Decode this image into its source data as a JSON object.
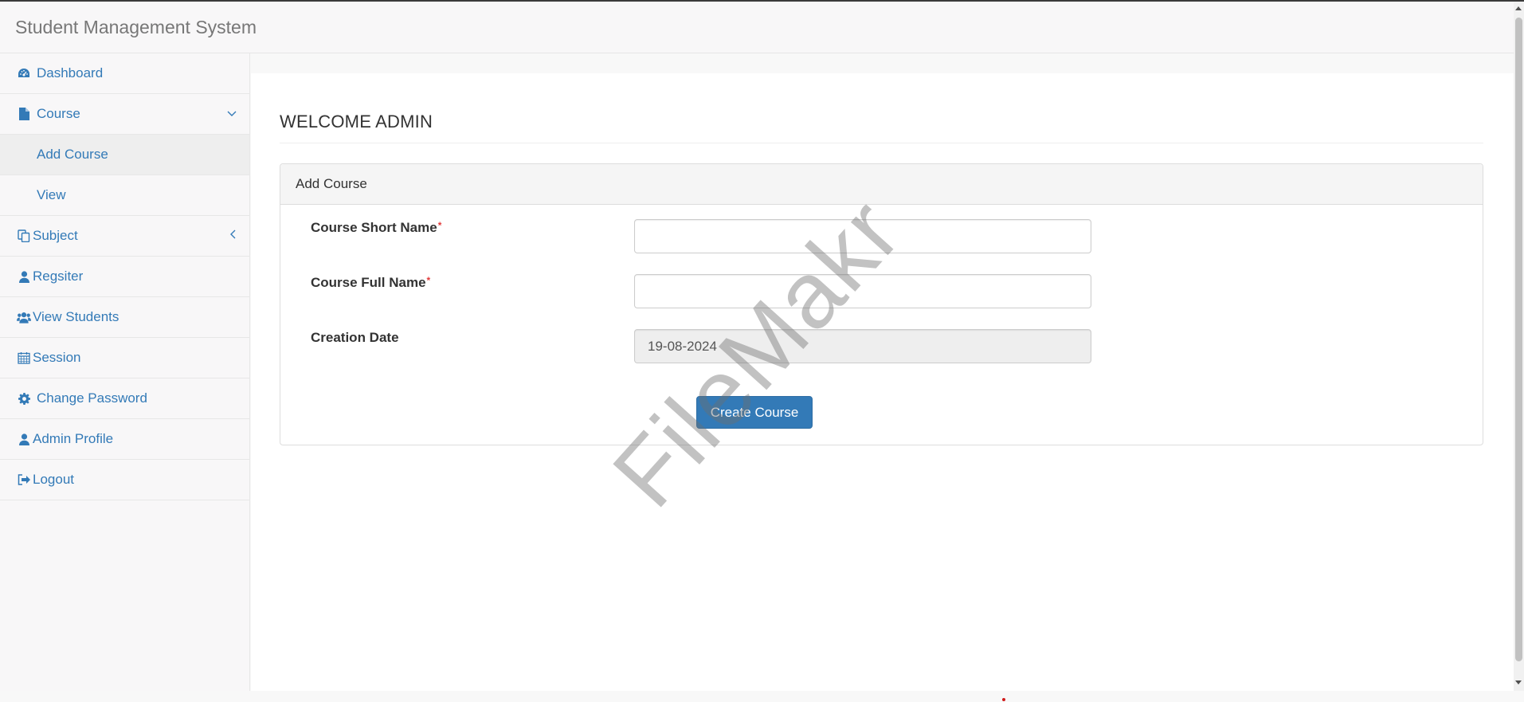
{
  "app": {
    "title": "Student Management System"
  },
  "sidebar": {
    "items": [
      {
        "label": "Dashboard",
        "icon": "dashboard-icon"
      },
      {
        "label": "Course",
        "icon": "file-icon",
        "expanded": true,
        "arrow": "chevron-down-icon",
        "children": [
          {
            "label": "Add Course",
            "active": true
          },
          {
            "label": "View"
          }
        ]
      },
      {
        "label": "Subject",
        "icon": "copy-icon",
        "arrow": "chevron-left-icon"
      },
      {
        "label": "Regsiter",
        "icon": "user-icon"
      },
      {
        "label": "View Students",
        "icon": "users-icon"
      },
      {
        "label": "Session",
        "icon": "calendar-icon"
      },
      {
        "label": "Change Password",
        "icon": "gear-icon"
      },
      {
        "label": "Admin Profile",
        "icon": "user-icon"
      },
      {
        "label": "Logout",
        "icon": "logout-icon"
      }
    ]
  },
  "main": {
    "page_title": "WELCOME ADMIN",
    "panel": {
      "heading": "Add Course",
      "fields": [
        {
          "label": "Course Short Name",
          "required": "*",
          "value": ""
        },
        {
          "label": "Course Full Name",
          "required": "*",
          "value": ""
        },
        {
          "label": "Creation Date",
          "value": "19-08-2024",
          "readonly": true
        }
      ],
      "submit_label": "Create Course"
    }
  },
  "watermark": "FileMakr",
  "colors": {
    "link": "#337ab7",
    "primary_button": "#337ab7",
    "required_mark": "#e23b3b"
  }
}
